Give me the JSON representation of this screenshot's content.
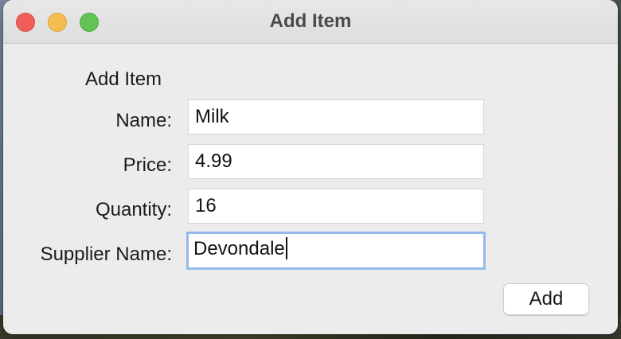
{
  "window": {
    "title": "Add Item"
  },
  "form": {
    "heading": "Add Item",
    "fields": [
      {
        "label": "Name:",
        "value": "Milk"
      },
      {
        "label": "Price:",
        "value": "4.99"
      },
      {
        "label": "Quantity:",
        "value": "16"
      },
      {
        "label": "Supplier Name:",
        "value": "Devondale",
        "focused": true
      }
    ],
    "submit_label": "Add"
  },
  "colors": {
    "close": "#ee5e57",
    "minimize": "#f5bd4f",
    "zoom": "#61c454",
    "focus_ring": "#97b9ea"
  }
}
